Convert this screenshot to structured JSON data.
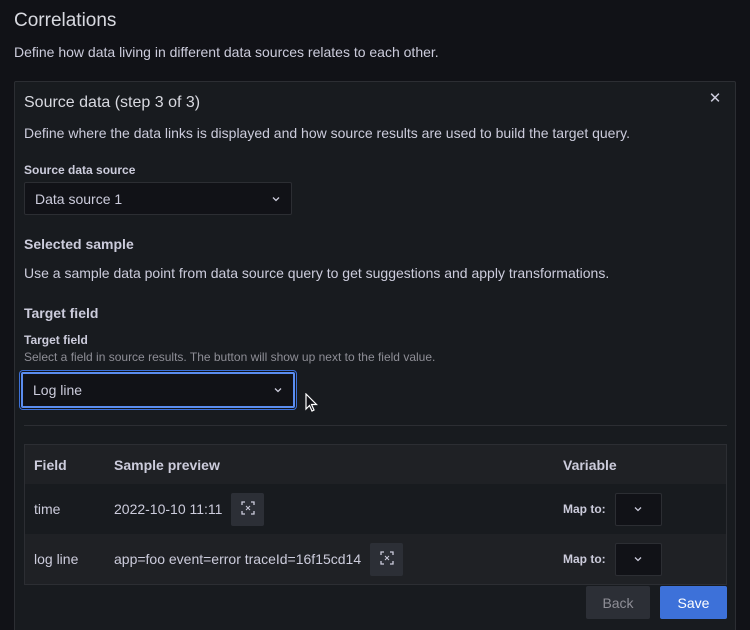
{
  "page": {
    "title": "Correlations",
    "description": "Define how data living in different data sources relates to each other."
  },
  "panel": {
    "title": "Source data (step 3 of 3)",
    "close_icon": "close-icon",
    "description": "Define where the data links is displayed and how source results are used to build the target query."
  },
  "source": {
    "label": "Source data source",
    "value": "Data source 1"
  },
  "sample": {
    "title": "Selected sample",
    "description": "Use a sample data point from data source query to get suggestions and apply transformations."
  },
  "target": {
    "section_title": "Target field",
    "label": "Target field",
    "hint": "Select a field in source results. The button will show up next to the field value.",
    "value": "Log line"
  },
  "table": {
    "headers": [
      "Field",
      "Sample preview",
      "Variable"
    ],
    "rows": [
      {
        "field": "time",
        "preview": "2022-10-10 11:11",
        "map_label": "Map to:"
      },
      {
        "field": "log line",
        "preview": "app=foo event=error traceId=16f15cd14",
        "map_label": "Map to:"
      }
    ]
  },
  "actions": {
    "back": "Back",
    "save": "Save"
  },
  "colors": {
    "background": "#111217",
    "panel": "#181b1f",
    "primary": "#3d71d9",
    "focus": "#5b8def"
  }
}
